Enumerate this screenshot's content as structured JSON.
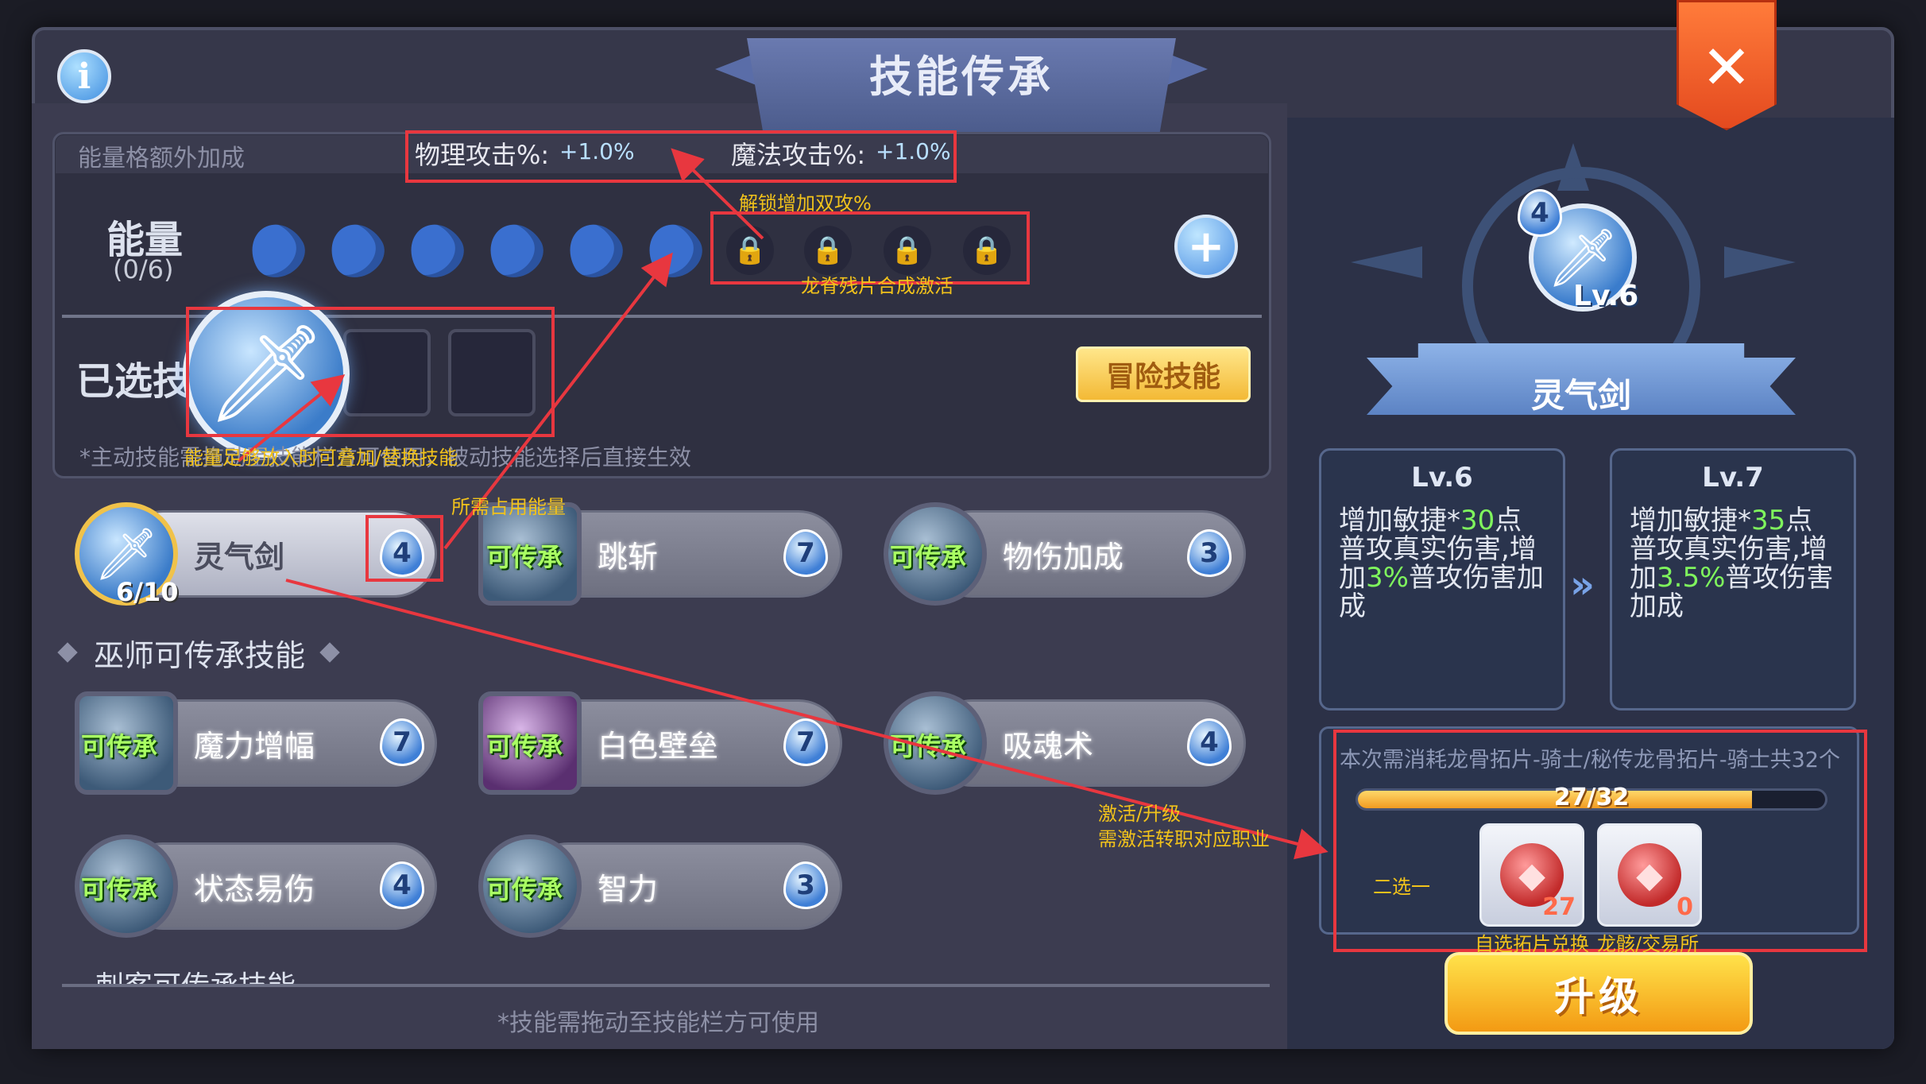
{
  "window": {
    "title": "技能传承"
  },
  "energy": {
    "bonus_label": "能量格额外加成",
    "phys_attack_label": "物理攻击%:",
    "phys_attack_value": "+1.0%",
    "mag_attack_label": "魔法攻击%:",
    "mag_attack_value": "+1.0%",
    "label": "能量",
    "count": "(0/6)",
    "filled": 6,
    "locked": 4
  },
  "selected": {
    "label": "已选技能",
    "adventure_button": "冒险技能",
    "note": "*主动技能需拖动至技能栏方可使用，被动技能选择后直接生效"
  },
  "skills_top": [
    {
      "name": "灵气剑",
      "cost": "4",
      "progress": "6/10",
      "tag": ""
    },
    {
      "name": "跳斩",
      "cost": "7",
      "tag": "可传承"
    },
    {
      "name": "物伤加成",
      "cost": "3",
      "tag": "可传承"
    }
  ],
  "section_title": "巫师可传承技能",
  "skills_wizard": [
    {
      "name": "魔力增幅",
      "cost": "7",
      "tag": "可传承"
    },
    {
      "name": "白色壁垒",
      "cost": "7",
      "tag": "可传承"
    },
    {
      "name": "吸魂术",
      "cost": "4",
      "tag": "可传承"
    },
    {
      "name": "状态易伤",
      "cost": "4",
      "tag": "可传承"
    },
    {
      "name": "智力",
      "cost": "3",
      "tag": "可传承"
    }
  ],
  "next_section": "刺客可传承技能",
  "drag_note": "*技能需拖动至技能栏方可使用",
  "detail": {
    "cost": "4",
    "level": "Lv.6",
    "name": "灵气剑",
    "current": {
      "lv": "Lv.6",
      "desc_a": "增加敏捷*",
      "hl1": "30",
      "desc_b": "点普攻真实伤害,增加",
      "hl2": "3%",
      "desc_c": "普攻伤害加成"
    },
    "next": {
      "lv": "Lv.7",
      "desc_a": "增加敏捷*",
      "hl1": "35",
      "desc_b": "点普攻真实伤害,增加",
      "hl2": "3.5%",
      "desc_c": "普攻伤害加成"
    },
    "upgrade_cost_text": "本次需消耗龙骨拓片-骑士/秘传龙骨拓片-骑士共32个",
    "progress_text": "27/32",
    "progress_fraction": 0.844,
    "items": [
      {
        "count": "27"
      },
      {
        "count": "0"
      }
    ],
    "upgrade_button": "升级"
  },
  "annotations": {
    "unlock": "解锁增加双攻%",
    "dragon_spine": "龙脊残片合成激活",
    "energy_enough": "能量足够放入时可叠加/替换技能",
    "energy_needed": "所需占用能量",
    "activate_1": "激活/升级",
    "activate_2": "需激活转职对应职业",
    "choose_one": "二选一",
    "item_1_label": "自选拓片兑换",
    "item_2_label": "龙骸/交易所"
  },
  "colors": {
    "accent_green": "#7ff55d",
    "annotation_red": "#e8373f",
    "annotation_yellow": "#f1c21b",
    "upgrade_orange": "#f39a13"
  }
}
